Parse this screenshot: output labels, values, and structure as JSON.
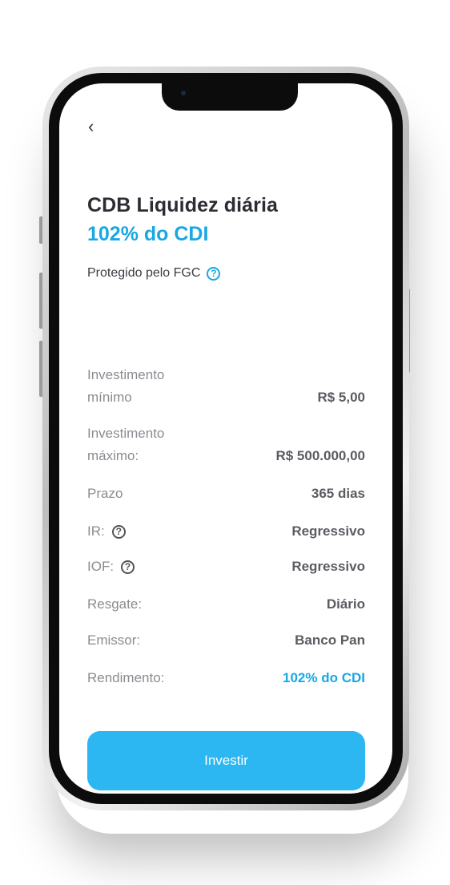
{
  "header": {
    "title": "CDB Liquidez diária",
    "rate": "102% do CDI",
    "protection": "Protegido pelo FGC"
  },
  "details": [
    {
      "label_line1": "Investimento",
      "label_line2": "mínimo",
      "value": "R$ 5,00"
    },
    {
      "label_line1": "Investimento",
      "label_line2": "máximo:",
      "value": "R$ 500.000,00"
    },
    {
      "label": "Prazo",
      "value": "365 dias"
    },
    {
      "label": "IR:",
      "value": "Regressivo"
    },
    {
      "label": "IOF:",
      "value": "Regressivo"
    },
    {
      "label": "Resgate:",
      "value": "Diário"
    },
    {
      "label": "Emissor:",
      "value": "Banco Pan"
    },
    {
      "label": "Rendimento:",
      "value": "102% do CDI"
    }
  ],
  "actions": {
    "invest_label": "Investir"
  },
  "icons": {
    "back": "chevron-left-icon",
    "help": "question-circle-icon"
  },
  "colors": {
    "accent": "#1aa7e3",
    "button": "#2cb6f2"
  }
}
